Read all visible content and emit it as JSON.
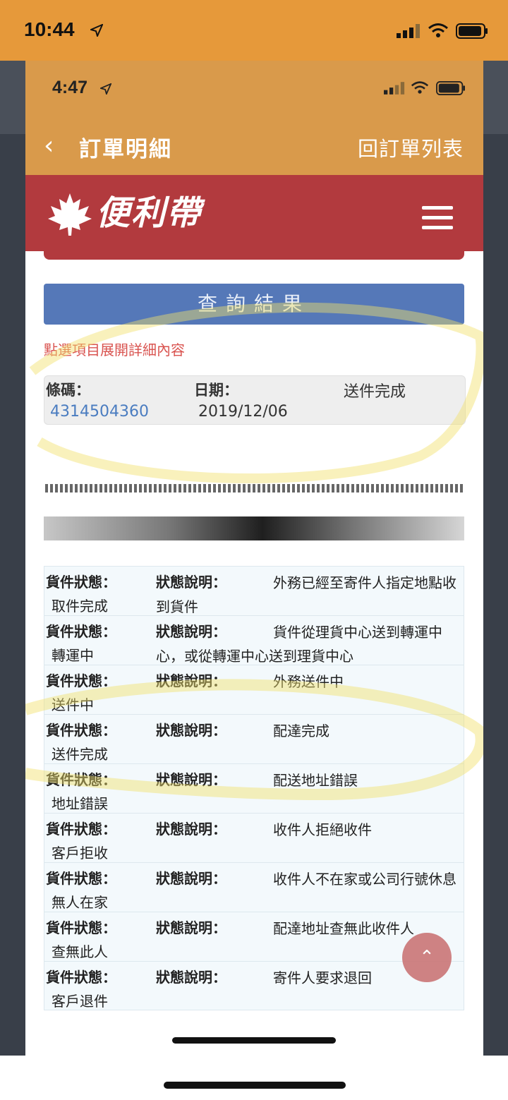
{
  "outer_status": {
    "time": "10:44"
  },
  "inner_status": {
    "time": "4:47"
  },
  "nav": {
    "title": "訂單明細",
    "right_link": "回訂單列表"
  },
  "brand": {
    "name": "便利帶"
  },
  "query_button": "查詢結果",
  "hint": "點選項目展開詳細內容",
  "summary": {
    "barcode_label": "條碼：",
    "barcode_value": "4314504360",
    "date_label": "日期：",
    "date_value": "2019/12/06",
    "status": "送件完成"
  },
  "status_list": {
    "status_label": "貨件狀態：",
    "desc_label": "狀態說明：",
    "items": [
      {
        "status": "取件完成",
        "desc": "外務已經至寄件人指定地點收到貨件"
      },
      {
        "status": "轉運中",
        "desc": "貨件從理貨中心送到轉運中心，或從轉運中心送到理貨中心"
      },
      {
        "status": "送件中",
        "desc": "外務送件中"
      },
      {
        "status": "送件完成",
        "desc": "配達完成"
      },
      {
        "status": "地址錯誤",
        "desc": "配送地址錯誤"
      },
      {
        "status": "客戶拒收",
        "desc": "收件人拒絕收件"
      },
      {
        "status": "無人在家",
        "desc": "收件人不在家或公司行號休息"
      },
      {
        "status": "查無此人",
        "desc": "配達地址查無此收件人"
      },
      {
        "status": "客戶退件",
        "desc": "寄件人要求退回"
      }
    ]
  },
  "colors": {
    "status_bar": "#e6993a",
    "nav": "#d99a4b",
    "brand_bar": "#b23a3e",
    "query_button": "#5578b8",
    "hint_text": "#d9534f",
    "barcode_link": "#4a7cc0"
  },
  "icons": {
    "back": "chevron-left-icon",
    "menu": "hamburger-menu-icon",
    "logo": "maple-leaf-icon",
    "scroll_top": "chevron-up-icon"
  }
}
